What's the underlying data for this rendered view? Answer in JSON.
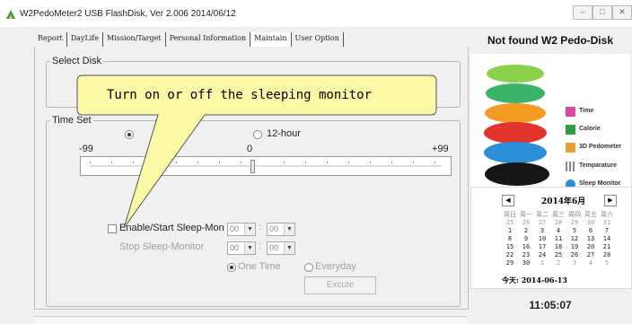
{
  "window": {
    "title": "W2PedoMeter2 USB FlashDisk, Ver 2.006  2014/06/12",
    "buttons": [
      "–",
      "□",
      "✕"
    ]
  },
  "tabs": [
    {
      "label": "Report"
    },
    {
      "label": "DayLife"
    },
    {
      "label": "Mission/Target"
    },
    {
      "label": "Personal Information"
    },
    {
      "label": "Maintain",
      "active": true
    },
    {
      "label": "User Option"
    }
  ],
  "select_disk": {
    "legend": "Select Disk"
  },
  "time_set": {
    "legend": "Time Set",
    "format_24": "",
    "format_12": "12-hour",
    "selected_format": "24-hour",
    "slider": {
      "min_label": "-99",
      "mid_label": "0",
      "max_label": "+99",
      "value": 0
    }
  },
  "sleep": {
    "enable_label": "Enable/Start Sleep-Mon",
    "start_hour": "00",
    "start_min": "00",
    "stop_label": "Stop Sleep-Monitor",
    "stop_hour": "00",
    "stop_min": "00",
    "one_time": "One Time",
    "everyday": "Everyday",
    "repeat_selected": "One Time",
    "execute_label": "Excute"
  },
  "callout": {
    "text": "Turn on or off the sleeping monitor"
  },
  "status": {
    "device": "Not found W2 Pedo-Disk",
    "clock": "11:05:07"
  },
  "feature_legend": [
    {
      "label": "Time",
      "color": "#d946a3"
    },
    {
      "label": "Calorie",
      "color": "#2ea043"
    },
    {
      "label": "3D Pedometer",
      "color": "#e8a033"
    },
    {
      "label": "Temparature",
      "color": "#888888"
    },
    {
      "label": "Sleep Monitor",
      "color": "#2a8fd6"
    }
  ],
  "calendar": {
    "month_label": "2014年6月",
    "weekdays": [
      "周日",
      "周一",
      "周二",
      "周三",
      "周四",
      "周五",
      "周六"
    ],
    "weeks": [
      [
        "25",
        "26",
        "27",
        "28",
        "29",
        "30",
        "31"
      ],
      [
        "1",
        "2",
        "3",
        "4",
        "5",
        "6",
        "7"
      ],
      [
        "8",
        "9",
        "10",
        "11",
        "12",
        "13",
        "14"
      ],
      [
        "15",
        "16",
        "17",
        "18",
        "19",
        "20",
        "21"
      ],
      [
        "22",
        "23",
        "24",
        "25",
        "26",
        "27",
        "28"
      ],
      [
        "29",
        "30",
        "1",
        "2",
        "3",
        "4",
        "5"
      ]
    ],
    "today_label": "今天: 2014-06-13"
  }
}
